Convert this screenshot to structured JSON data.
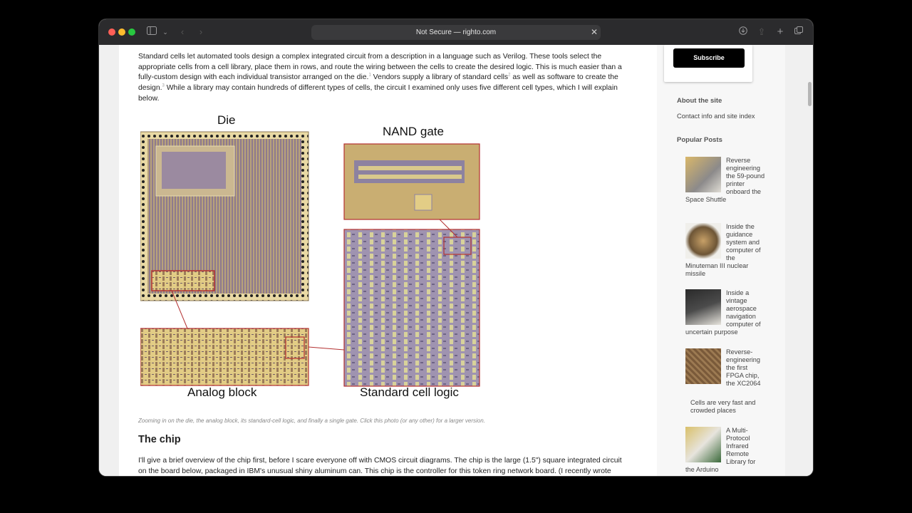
{
  "browser": {
    "address": "Not Secure — righto.com"
  },
  "article": {
    "para1_parts": [
      "Standard cells let automated tools design a complex integrated circuit from a description in a language such as Verilog. These tools select the",
      "appropriate cells from a cell library, place them in rows, and route the wiring between the cells to create the desired logic. This is much easier than a",
      "fully-custom design with each individual transistor arranged on the die.",
      "1",
      " Vendors supply a library of standard cells",
      "2",
      " as well as software to create the",
      "design.",
      "3",
      " While a library may contain hundreds of different types of cells, the circuit I examined only uses five different cell types, which I will explain",
      "below."
    ],
    "figure": {
      "label_die": "Die",
      "label_nand": "NAND gate",
      "label_analog": "Analog block",
      "label_stdcell": "Standard cell logic"
    },
    "caption": "Zooming in on the die, the analog block, its standard-cell logic, and finally a single gate. Click this photo (or any other) for a larger version.",
    "heading": "The chip",
    "para2_lines": [
      "I'll give a brief overview of the chip first, before I scare everyone off with CMOS circuit diagrams. The chip is the large (1.5\") square integrated circuit",
      "on the board below, packaged in IBM's unusual shiny aluminum can. This chip is the controller for this token ring network board. (I recently wrote"
    ]
  },
  "sidebar": {
    "subscribe_label": "Subscribe",
    "about_heading": "About the site",
    "contact_link": "Contact info and site index",
    "popular_heading": "Popular Posts",
    "posts": [
      {
        "title": "Reverse engineering the 59-pound printer onboard the Space Shuttle",
        "icon": "printer-photo"
      },
      {
        "title": "Inside the guidance system and computer of the Minuteman III nuclear missile",
        "icon": "guidance-photo"
      },
      {
        "title": "Inside a vintage aerospace navigation computer of uncertain purpose",
        "icon": "nav-computer-photo"
      },
      {
        "title": "Reverse-engineering the first FPGA chip, the XC2064",
        "icon": "fpga-photo"
      },
      {
        "title": "Cells are very fast and crowded places",
        "icon": ""
      },
      {
        "title": "A Multi-Protocol Infrared Remote Library for the Arduino",
        "icon": "arduino-photo"
      }
    ]
  },
  "colors": {
    "accent_red": "#b33030",
    "die_tan": "#d8c48f",
    "cell_purple": "#9f93b0"
  }
}
